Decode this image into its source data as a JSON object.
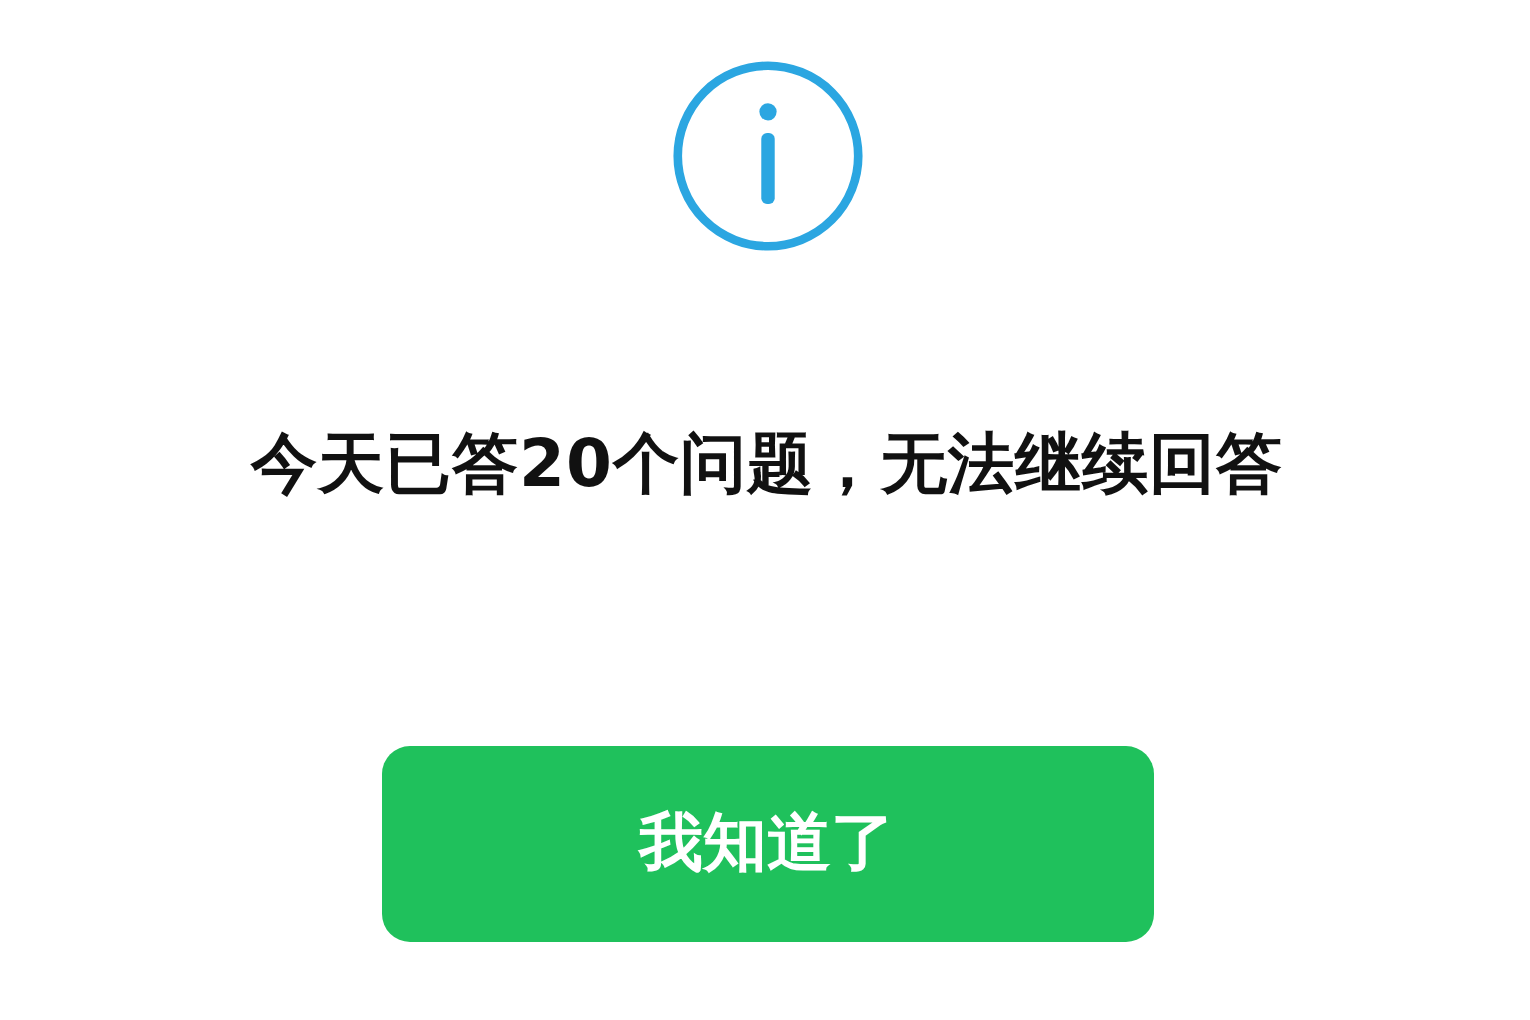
{
  "dialog": {
    "message": "今天已答20个问题，无法继续回答",
    "buttons": [
      {
        "label": "我知道了",
        "kind": "primary"
      }
    ]
  }
}
